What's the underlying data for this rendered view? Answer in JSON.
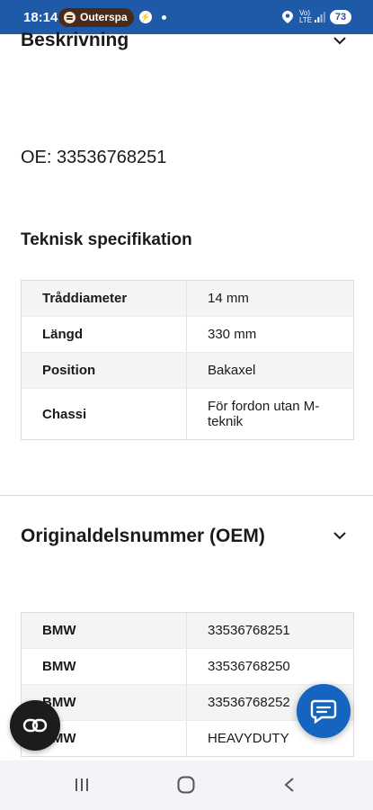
{
  "status_bar": {
    "time": "18:14",
    "spotify_label": "Outerspa",
    "volte_line1": "Vo)",
    "volte_line2": "LTE",
    "battery": "73",
    "colors": {
      "background": "#1e5aa8",
      "spotify_pill": "#4a2a18"
    }
  },
  "description": {
    "title": "Beskrivning",
    "oe_text": "OE: 33536768251",
    "spec_title": "Teknisk specifikation",
    "spec_rows": [
      {
        "key": "Tråddiameter",
        "value": "14 mm"
      },
      {
        "key": "Längd",
        "value": "330 mm"
      },
      {
        "key": "Position",
        "value": "Bakaxel"
      },
      {
        "key": "Chassi",
        "value": "För fordon utan M-teknik"
      }
    ]
  },
  "oem": {
    "title": "Originaldelsnummer (OEM)",
    "rows": [
      {
        "brand": "BMW",
        "number": "33536768251"
      },
      {
        "brand": "BMW",
        "number": "33536768250"
      },
      {
        "brand": "BMW",
        "number": "33536768252"
      },
      {
        "brand": "BMW",
        "number": "HEAVYDUTY"
      }
    ]
  },
  "icons": {
    "chevron": "chevron-down-icon",
    "fab_left": "link-icon",
    "fab_right": "chat-icon",
    "nav": [
      "recents-icon",
      "home-icon",
      "back-icon"
    ]
  },
  "colors": {
    "fab_chat": "#1565c0",
    "fab_link": "#1c1c1c"
  }
}
